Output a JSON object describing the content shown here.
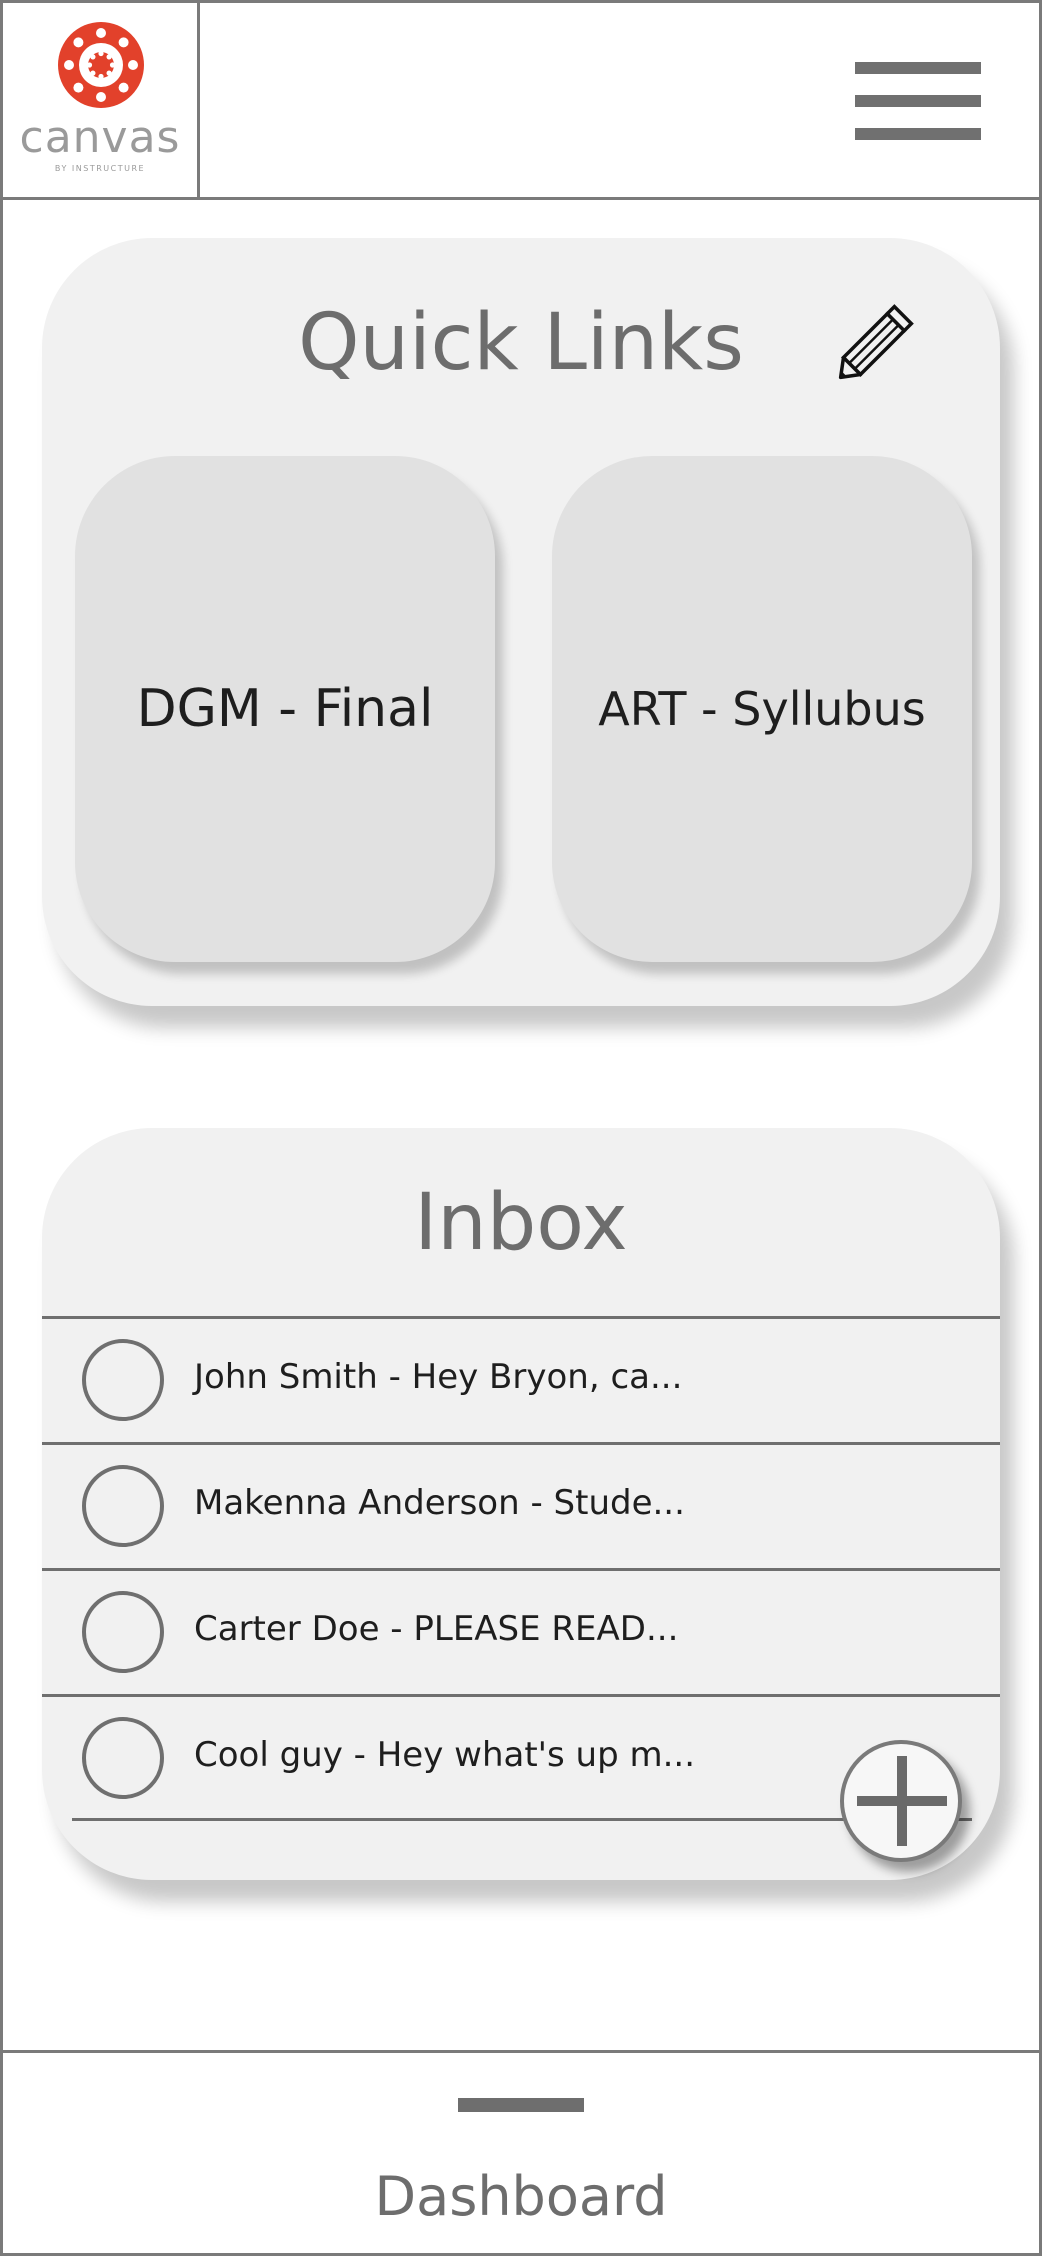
{
  "brand": {
    "name": "canvas",
    "tagline": "BY INSTRUCTURE",
    "logo_color": "#e2412b"
  },
  "header": {
    "menu_icon": "hamburger-menu-icon"
  },
  "quick_links": {
    "title": "Quick Links",
    "edit_icon": "pencil-icon",
    "items": [
      {
        "label": "DGM - Final"
      },
      {
        "label": "ART - Syllubus"
      }
    ]
  },
  "inbox": {
    "title": "Inbox",
    "messages": [
      {
        "text": "John Smith - Hey Bryon, ca..."
      },
      {
        "text": "Makenna Anderson - Stude..."
      },
      {
        "text": "Carter Doe - PLEASE READ..."
      },
      {
        "text": "Cool guy - Hey what's up m..."
      }
    ],
    "add_icon": "plus-icon"
  },
  "footer": {
    "label": "Dashboard"
  }
}
